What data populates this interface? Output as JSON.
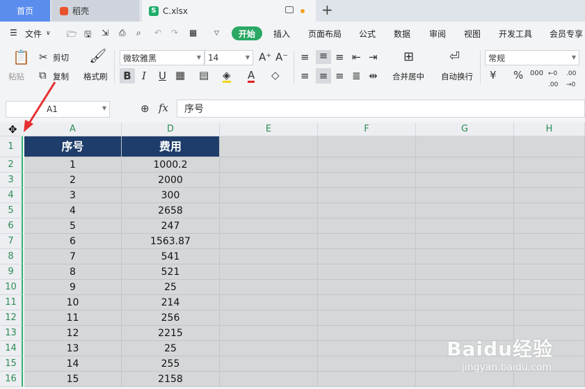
{
  "tabs": {
    "home": "首页",
    "doke": "稻壳",
    "file": "C.xlsx",
    "xl_badge": "S"
  },
  "menu": {
    "file": "文件",
    "items": [
      "插入",
      "页面布局",
      "公式",
      "数据",
      "审阅",
      "视图",
      "开发工具",
      "会员专享"
    ],
    "active": "开始"
  },
  "toolbar": {
    "paste": "粘贴",
    "cut": "剪切",
    "copy": "复制",
    "format_painter": "格式刷",
    "font_name": "微软雅黑",
    "font_size": "14",
    "merge": "合并居中",
    "wrap": "自动换行",
    "number_format": "常规",
    "bold": "B",
    "italic": "I",
    "underline": "U",
    "font_color": "A"
  },
  "formula_bar": {
    "cell_ref": "A1",
    "fx": "fx",
    "content": "序号"
  },
  "columns": [
    "A",
    "D",
    "E",
    "F",
    "G",
    "H"
  ],
  "rows": [
    "1",
    "2",
    "3",
    "4",
    "5",
    "6",
    "7",
    "8",
    "9",
    "10",
    "11",
    "12",
    "13",
    "14",
    "15",
    "16"
  ],
  "table": {
    "headers": [
      "序号",
      "费用"
    ],
    "data": [
      [
        "1",
        "1000.2"
      ],
      [
        "2",
        "2000"
      ],
      [
        "3",
        "300"
      ],
      [
        "4",
        "2658"
      ],
      [
        "5",
        "247"
      ],
      [
        "6",
        "1563.87"
      ],
      [
        "7",
        "541"
      ],
      [
        "8",
        "521"
      ],
      [
        "9",
        "25"
      ],
      [
        "10",
        "214"
      ],
      [
        "11",
        "256"
      ],
      [
        "12",
        "2215"
      ],
      [
        "13",
        "25"
      ],
      [
        "14",
        "255"
      ],
      [
        "15",
        "2158"
      ]
    ]
  },
  "watermark": {
    "brand": "Baidu经验",
    "url": "jingyan.baidu.com"
  },
  "colors": {
    "accent": "#2aa864",
    "header_fill": "#1e3d6b",
    "tab_blue": "#5b8def"
  }
}
